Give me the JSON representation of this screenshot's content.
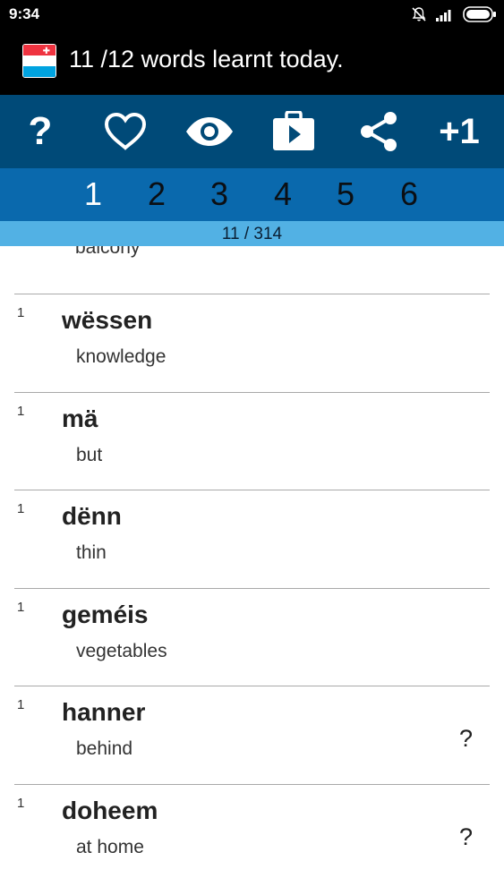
{
  "status": {
    "time": "9:34"
  },
  "header": {
    "title": "11 /12 words learnt today."
  },
  "toolbar": {
    "help_label": "?",
    "plus_label": "+1"
  },
  "levels": [
    "1",
    "2",
    "3",
    "4",
    "5",
    "6"
  ],
  "progress": {
    "text": "11 / 314"
  },
  "partial_item": {
    "translation": "balcony"
  },
  "items": [
    {
      "count": "1",
      "word": "wëssen",
      "translation": "knowledge",
      "mark": ""
    },
    {
      "count": "1",
      "word": "mä",
      "translation": "but",
      "mark": ""
    },
    {
      "count": "1",
      "word": "dënn",
      "translation": "thin",
      "mark": ""
    },
    {
      "count": "1",
      "word": "geméis",
      "translation": "vegetables",
      "mark": ""
    },
    {
      "count": "1",
      "word": "hanner",
      "translation": "behind",
      "mark": "?"
    },
    {
      "count": "1",
      "word": "doheem",
      "translation": "at home",
      "mark": "?"
    }
  ]
}
